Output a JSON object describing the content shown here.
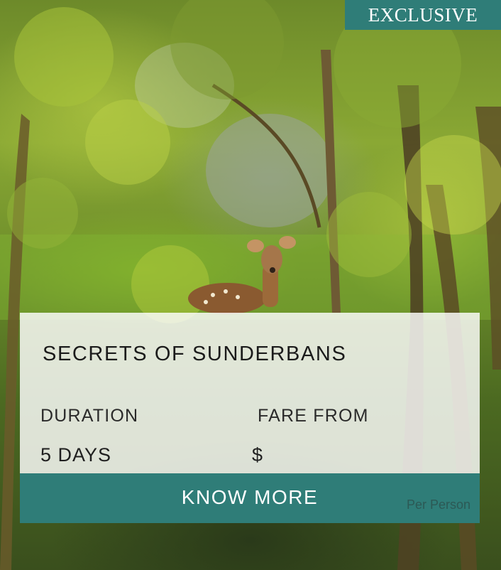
{
  "badge": {
    "label": "EXCLUSIVE"
  },
  "tour": {
    "title": "SECRETS OF SUNDERBANS",
    "duration_label": "DURATION",
    "duration_value": "5 DAYS",
    "fare_label": "FARE FROM",
    "fare_value": "$",
    "per_person": "Per Person"
  },
  "cta": {
    "label": "KNOW MORE"
  },
  "colors": {
    "accent": "#2f7d78",
    "card": "#ffffff"
  },
  "hero": {
    "image": "forest-with-deer-photo"
  }
}
